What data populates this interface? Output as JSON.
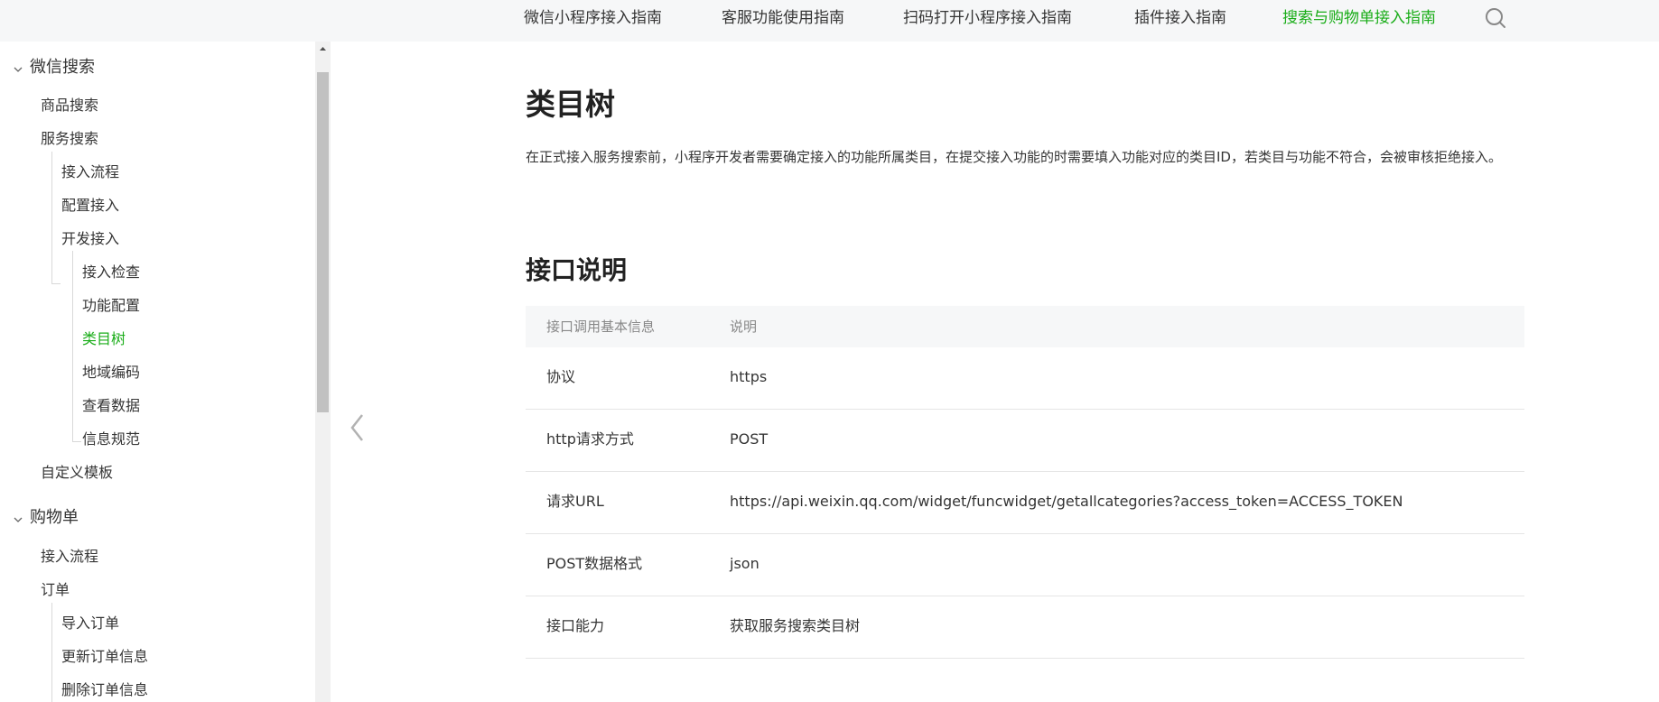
{
  "topnav": {
    "items": [
      {
        "label": "微信小程序接入指南"
      },
      {
        "label": "客服功能使用指南"
      },
      {
        "label": "扫码打开小程序接入指南"
      },
      {
        "label": "插件接入指南"
      },
      {
        "label": "搜索与购物单接入指南",
        "active": true
      }
    ]
  },
  "sidebar": {
    "groups": [
      {
        "label": "微信搜索"
      },
      {
        "label": "购物单"
      }
    ],
    "items": [
      {
        "label": "商品搜索"
      },
      {
        "label": "服务搜索"
      },
      {
        "label": "接入流程"
      },
      {
        "label": "配置接入"
      },
      {
        "label": "开发接入"
      },
      {
        "label": "接入检查"
      },
      {
        "label": "功能配置"
      },
      {
        "label": "类目树",
        "active": true
      },
      {
        "label": "地域编码"
      },
      {
        "label": "查看数据"
      },
      {
        "label": "信息规范"
      },
      {
        "label": "自定义模板"
      },
      {
        "label": "接入流程"
      },
      {
        "label": "订单"
      },
      {
        "label": "导入订单"
      },
      {
        "label": "更新订单信息"
      },
      {
        "label": "删除订单信息"
      }
    ]
  },
  "main": {
    "title": "类目树",
    "intro": "在正式接入服务搜索前，小程序开发者需要确定接入的功能所属类目，在提交接入功能的时需要填入功能对应的类目ID，若类目与功能不符合，会被审核拒绝接入。",
    "section_title": "接口说明",
    "table": {
      "headers": [
        "接口调用基本信息",
        "说明"
      ],
      "rows": [
        [
          "协议",
          "https"
        ],
        [
          "http请求方式",
          "POST"
        ],
        [
          "请求URL",
          "https://api.weixin.qq.com/widget/funcwidget/getallcategories?access_token=ACCESS_TOKEN"
        ],
        [
          "POST数据格式",
          "json"
        ],
        [
          "接口能力",
          "获取服务搜索类目树"
        ]
      ]
    }
  },
  "colors": {
    "accent": "#1aad19",
    "text": "#353535",
    "header_bg": "#f6f7f8"
  },
  "icons": {
    "search": "search-icon",
    "prev": "chevron-left-icon",
    "expand": "chevron-down-icon"
  }
}
